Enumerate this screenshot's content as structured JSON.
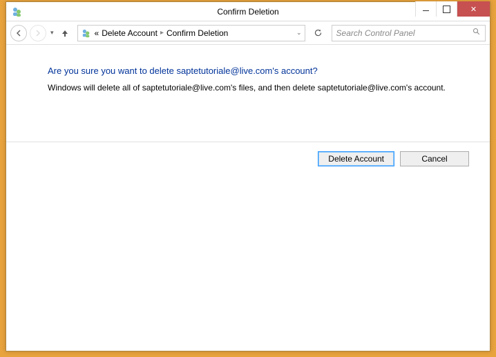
{
  "window": {
    "title": "Confirm Deletion"
  },
  "breadcrumb": {
    "prefix": "«",
    "items": [
      "Delete Account",
      "Confirm Deletion"
    ]
  },
  "search": {
    "placeholder": "Search Control Panel"
  },
  "main": {
    "heading": "Are you sure you want to delete saptetutoriale@live.com's account?",
    "body": "Windows will delete all of saptetutoriale@live.com's files, and then delete saptetutoriale@live.com's account."
  },
  "actions": {
    "primary": "Delete Account",
    "cancel": "Cancel"
  }
}
